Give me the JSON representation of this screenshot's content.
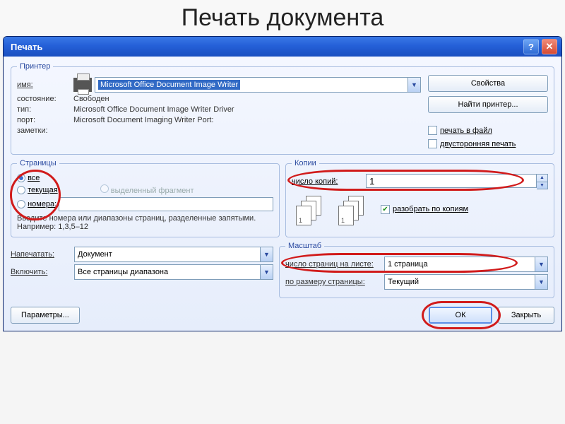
{
  "page_title": "Печать документа",
  "dialog": {
    "title": "Печать"
  },
  "printer": {
    "legend": "Принтер",
    "name_label": "имя:",
    "name_value": "Microsoft Office Document Image Writer",
    "state_label": "состояние:",
    "state_value": "Свободен",
    "type_label": "тип:",
    "type_value": "Microsoft Office Document Image Writer Driver",
    "port_label": "порт:",
    "port_value": "Microsoft Document Imaging Writer Port:",
    "notes_label": "заметки:",
    "properties_btn": "Свойства",
    "find_printer_btn": "Найти принтер...",
    "print_to_file": "печать в файл",
    "duplex": "двусторонняя печать"
  },
  "pages": {
    "legend": "Страницы",
    "all": "все",
    "current": "текущая",
    "range": "номера:",
    "selection": "выделенный фрагмент",
    "hint": "Введите номера или диапазоны страниц, разделенные запятыми. Например: 1,3,5–12"
  },
  "copies": {
    "legend": "Копии",
    "count_label": "число копий:",
    "count_value": "1",
    "collate": "разобрать по копиям"
  },
  "print_what": {
    "print_label": "Напечатать:",
    "print_value": "Документ",
    "include_label": "Включить:",
    "include_value": "Все страницы диапазона"
  },
  "zoom": {
    "legend": "Масштаб",
    "pages_per_sheet_label": "число страниц на листе:",
    "pages_per_sheet_value": "1 страница",
    "scale_label": "по размеру страницы:",
    "scale_value": "Текущий"
  },
  "footer": {
    "options_btn": "Параметры...",
    "ok_btn": "ОК",
    "close_btn": "Закрыть"
  }
}
